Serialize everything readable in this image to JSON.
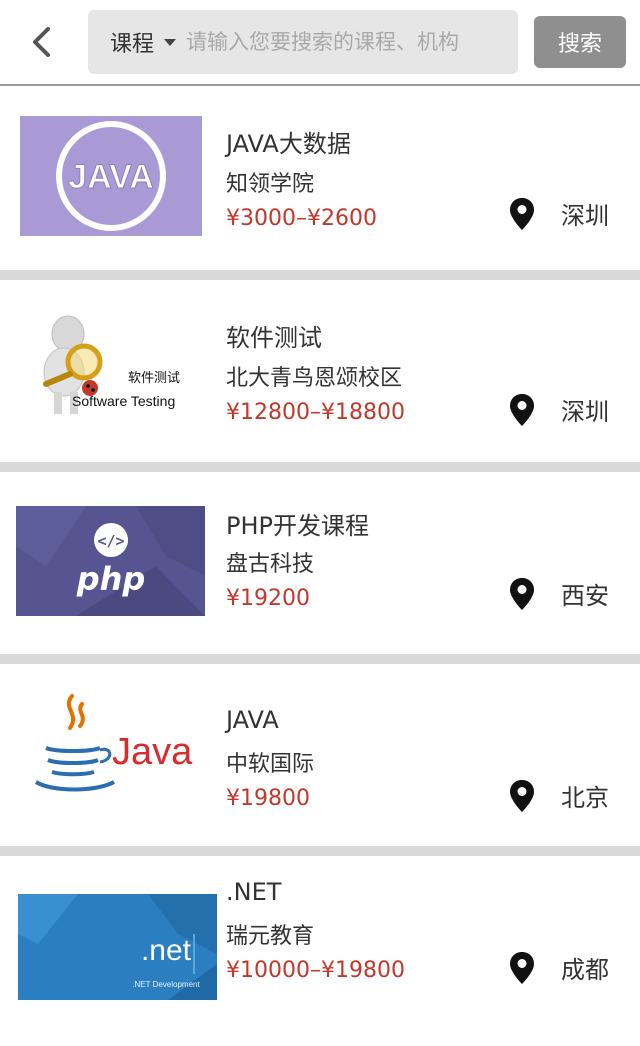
{
  "header": {
    "category_label": "课程",
    "search_placeholder": "请输入您要搜索的课程、机构",
    "search_button": "搜索"
  },
  "courses": [
    {
      "title": "JAVA大数据",
      "org": "知领学院",
      "price": "¥3000–¥2600",
      "city": "深圳",
      "thumb_text": "JAVA",
      "thumb_icon": "java-circle-logo"
    },
    {
      "title": "软件测试",
      "org": "北大青鸟恩颂校区",
      "price": "¥12800–¥18800",
      "city": "深圳",
      "thumb_caption_cn": "软件测试",
      "thumb_caption_en": "Software Testing",
      "thumb_icon": "magnifier-figure"
    },
    {
      "title": "PHP开发课程",
      "org": "盘古科技",
      "price": "¥19200",
      "city": "西安",
      "thumb_text": "php",
      "thumb_icon": "code-brackets"
    },
    {
      "title": "JAVA",
      "org": "中软国际",
      "price": "¥19800",
      "city": "北京",
      "thumb_text": "Java",
      "thumb_icon": "java-cup-logo"
    },
    {
      "title": ".NET",
      "org": "瑞元教育",
      "price": "¥10000–¥19800",
      "city": "成都",
      "thumb_text": ".net",
      "thumb_subtext": ".NET Development",
      "thumb_icon": "dotnet-logo"
    }
  ],
  "colors": {
    "price": "#c0392b",
    "separator": "#d9d9d9",
    "search_button": "#8f8f8f"
  }
}
